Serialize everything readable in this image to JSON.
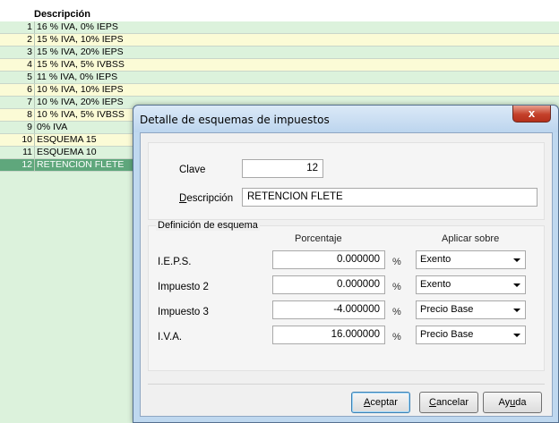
{
  "grid": {
    "header": "Descripción",
    "rows": [
      {
        "num": "1",
        "desc": "16 % IVA, 0% IEPS"
      },
      {
        "num": "2",
        "desc": "15 % IVA, 10% IEPS"
      },
      {
        "num": "3",
        "desc": "15 % IVA, 20% IEPS"
      },
      {
        "num": "4",
        "desc": "15 % IVA, 5% IVBSS"
      },
      {
        "num": "5",
        "desc": "11 % IVA, 0% IEPS"
      },
      {
        "num": "6",
        "desc": "10 % IVA, 10% IEPS"
      },
      {
        "num": "7",
        "desc": "10 % IVA, 20% IEPS"
      },
      {
        "num": "8",
        "desc": "10 % IVA, 5% IVBSS"
      },
      {
        "num": "9",
        "desc": "0% IVA"
      },
      {
        "num": "10",
        "desc": "ESQUEMA 15"
      },
      {
        "num": "11",
        "desc": "ESQUEMA 10"
      },
      {
        "num": "12",
        "desc": "RETENCION FLETE"
      }
    ]
  },
  "dialog": {
    "title": "Detalle de esquemas de impuestos",
    "close_label": "x",
    "clave_label": "Clave",
    "clave_value": "12",
    "descripcion_label_first": "D",
    "descripcion_label_rest": "escripción",
    "descripcion_value": "RETENCION FLETE",
    "section_title": "Definición de esquema",
    "col_porcentaje": "Porcentaje",
    "col_aplicar": "Aplicar sobre",
    "pct_symbol": "%",
    "rows": [
      {
        "label": "I.E.P.S.",
        "value": "0.000000",
        "apply": "Exento"
      },
      {
        "label": "Impuesto 2",
        "value": "0.000000",
        "apply": "Exento"
      },
      {
        "label": "Impuesto 3",
        "value": "-4.000000",
        "apply": "Precio Base"
      },
      {
        "label": "I.V.A.",
        "value": "16.000000",
        "apply": "Precio Base"
      }
    ],
    "buttons": {
      "aceptar_first": "A",
      "aceptar_rest": "ceptar",
      "cancelar_first": "C",
      "cancelar_rest": "ancelar",
      "ayuda_first": "Ay",
      "ayuda_u": "u",
      "ayuda_rest": "da"
    }
  }
}
